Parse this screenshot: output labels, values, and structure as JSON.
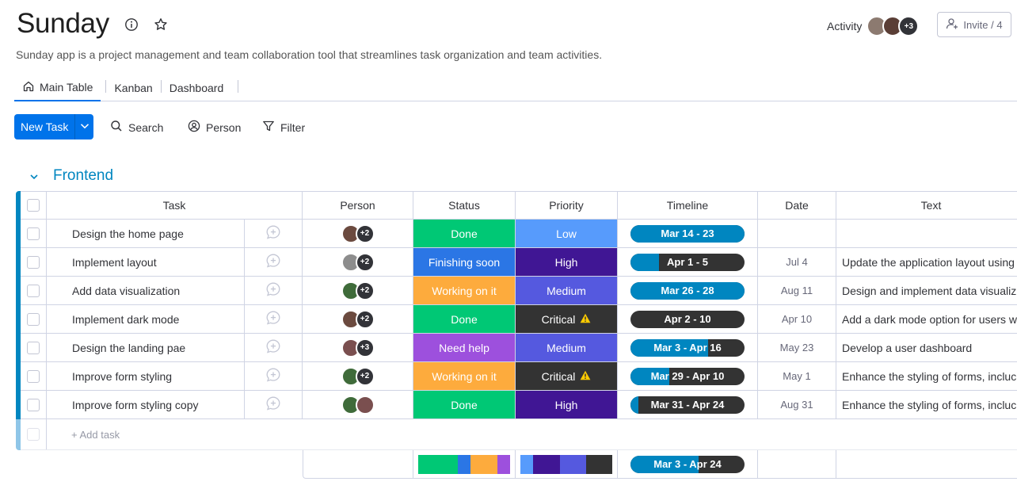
{
  "app": {
    "title": "Sunday",
    "description": "Sunday app is a project management and team collaboration tool that streamlines task organization and team activities."
  },
  "header": {
    "activity_label": "Activity",
    "activity_more": "+3",
    "invite_label": "Invite / 4"
  },
  "tabs": [
    {
      "label": "Main Table",
      "icon": "home-icon",
      "active": true
    },
    {
      "label": "Kanban",
      "active": false
    },
    {
      "label": "Dashboard",
      "active": false
    }
  ],
  "toolbar": {
    "new_task_label": "New Task",
    "search_label": "Search",
    "person_label": "Person",
    "filter_label": "Filter"
  },
  "group": {
    "title": "Frontend",
    "color": "#0086c0",
    "add_task_label": "+ Add task"
  },
  "columns": {
    "task": "Task",
    "person": "Person",
    "status": "Status",
    "priority": "Priority",
    "timeline": "Timeline",
    "date": "Date",
    "text": "Text"
  },
  "colors": {
    "Done": "#00c875",
    "Finishing soon": "#2b76e5",
    "Working on it": "#fdab3d",
    "Need help": "#9d50dd",
    "Low": "#579bfc",
    "High": "#401694",
    "Medium": "#5559df",
    "Critical": "#333333",
    "accent": "#0073ea"
  },
  "rows": [
    {
      "task": "Design the home page",
      "person_more": "+2",
      "status": "Done",
      "priority": "Low",
      "critical": false,
      "timeline": "Mar 14 - 23",
      "timeline_progress": 1.0,
      "date": "",
      "text": ""
    },
    {
      "task": "Implement layout",
      "person_more": "+2",
      "status": "Finishing soon",
      "priority": "High",
      "critical": false,
      "timeline": "Apr 1 - 5",
      "timeline_progress": 0.25,
      "date": "Jul 4",
      "text": "Update the application layout using"
    },
    {
      "task": "Add data visualization",
      "person_more": "+2",
      "status": "Working on it",
      "priority": "Medium",
      "critical": false,
      "timeline": "Mar 26 - 28",
      "timeline_progress": 1.0,
      "date": "Aug 11",
      "text": "Design and implement data visualiz"
    },
    {
      "task": "Implement dark mode",
      "person_more": "+2",
      "status": "Done",
      "priority": "Critical",
      "critical": true,
      "timeline": "Apr 2 - 10",
      "timeline_progress": 0.0,
      "date": "Apr 10",
      "text": "Add a dark mode option for users w"
    },
    {
      "task": "Design the landing pae",
      "person_more": "+3",
      "status": "Need help",
      "priority": "Medium",
      "critical": false,
      "timeline": "Mar 3 - Apr 16",
      "timeline_progress": 0.68,
      "date": "May 23",
      "text": "Develop a user dashboard"
    },
    {
      "task": "Improve form styling",
      "person_more": "+2",
      "status": "Working on it",
      "priority": "Critical",
      "critical": true,
      "timeline": "Mar 29 - Apr 10",
      "timeline_progress": 0.34,
      "date": "May 1",
      "text": "Enhance the styling of forms, incluc"
    },
    {
      "task": "Improve form styling copy",
      "person_more": "",
      "status": "Done",
      "priority": "High",
      "critical": false,
      "timeline": "Mar 31 - Apr 24",
      "timeline_progress": 0.07,
      "date": "Aug 31",
      "text": "Enhance the styling of forms, incluc"
    }
  ],
  "summary": {
    "timeline": "Mar 3 - Apr 24",
    "timeline_progress": 0.6,
    "status_mix": [
      {
        "label": "Done",
        "share": 0.43
      },
      {
        "label": "Finishing soon",
        "share": 0.14
      },
      {
        "label": "Working on it",
        "share": 0.29
      },
      {
        "label": "Need help",
        "share": 0.14
      }
    ],
    "priority_mix": [
      {
        "label": "Low",
        "share": 0.14
      },
      {
        "label": "High",
        "share": 0.29
      },
      {
        "label": "Medium",
        "share": 0.29
      },
      {
        "label": "Critical",
        "share": 0.28
      }
    ]
  }
}
